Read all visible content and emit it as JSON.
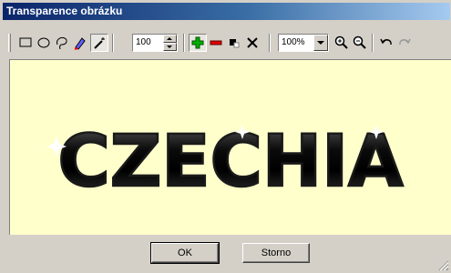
{
  "window": {
    "title": "Transparence obrázku"
  },
  "toolbar": {
    "tools": [
      {
        "name": "rectangle-select-icon"
      },
      {
        "name": "ellipse-select-icon"
      },
      {
        "name": "lasso-select-icon"
      },
      {
        "name": "pen-tool-icon"
      },
      {
        "name": "magic-wand-icon"
      }
    ],
    "tolerance_value": "100",
    "zoom_value": "100%"
  },
  "canvas": {
    "text": "CZECHIA",
    "background": "#ffffcc"
  },
  "buttons": {
    "ok_label": "OK",
    "cancel_label": "Storno"
  }
}
